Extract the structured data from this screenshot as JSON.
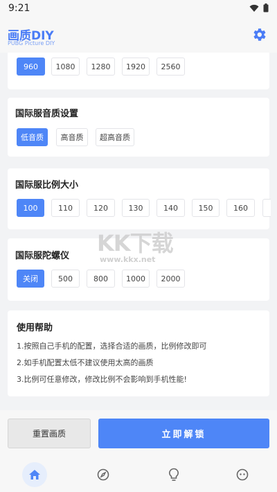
{
  "status": {
    "time": "9:21"
  },
  "app": {
    "title": "画质DIY",
    "subtitle": "PUBG Picture DIY"
  },
  "resolution": {
    "options": [
      "960",
      "1080",
      "1280",
      "1920",
      "2560"
    ],
    "selected": "960"
  },
  "audio": {
    "title": "国际服音质设置",
    "options": [
      "低音质",
      "高音质",
      "超高音质"
    ],
    "selected": "低音质"
  },
  "ratio": {
    "title": "国际服比例大小",
    "options": [
      "100",
      "110",
      "120",
      "130",
      "140",
      "150",
      "160"
    ],
    "selected": "100"
  },
  "gyro": {
    "title": "国际服陀螺仪",
    "options": [
      "关闭",
      "500",
      "800",
      "1000",
      "2000"
    ],
    "selected": "关闭"
  },
  "help": {
    "title": "使用帮助",
    "lines": [
      "1.按照自己手机的配置，选择合适的画质，比例修改即可",
      "2.如手机配置太低不建议使用太高的画质",
      "3.比例可任意修改，修改比例不会影响到手机性能!"
    ]
  },
  "actions": {
    "reset": "重置画质",
    "unlock": "立即解锁"
  },
  "watermark": {
    "logo": "KK下载",
    "url": "www.kkx.net"
  },
  "nav": [
    "home-icon",
    "compass-icon",
    "bulb-icon",
    "face-icon"
  ],
  "colors": {
    "accent": "#4e86f7",
    "title": "#4a7cf6"
  }
}
